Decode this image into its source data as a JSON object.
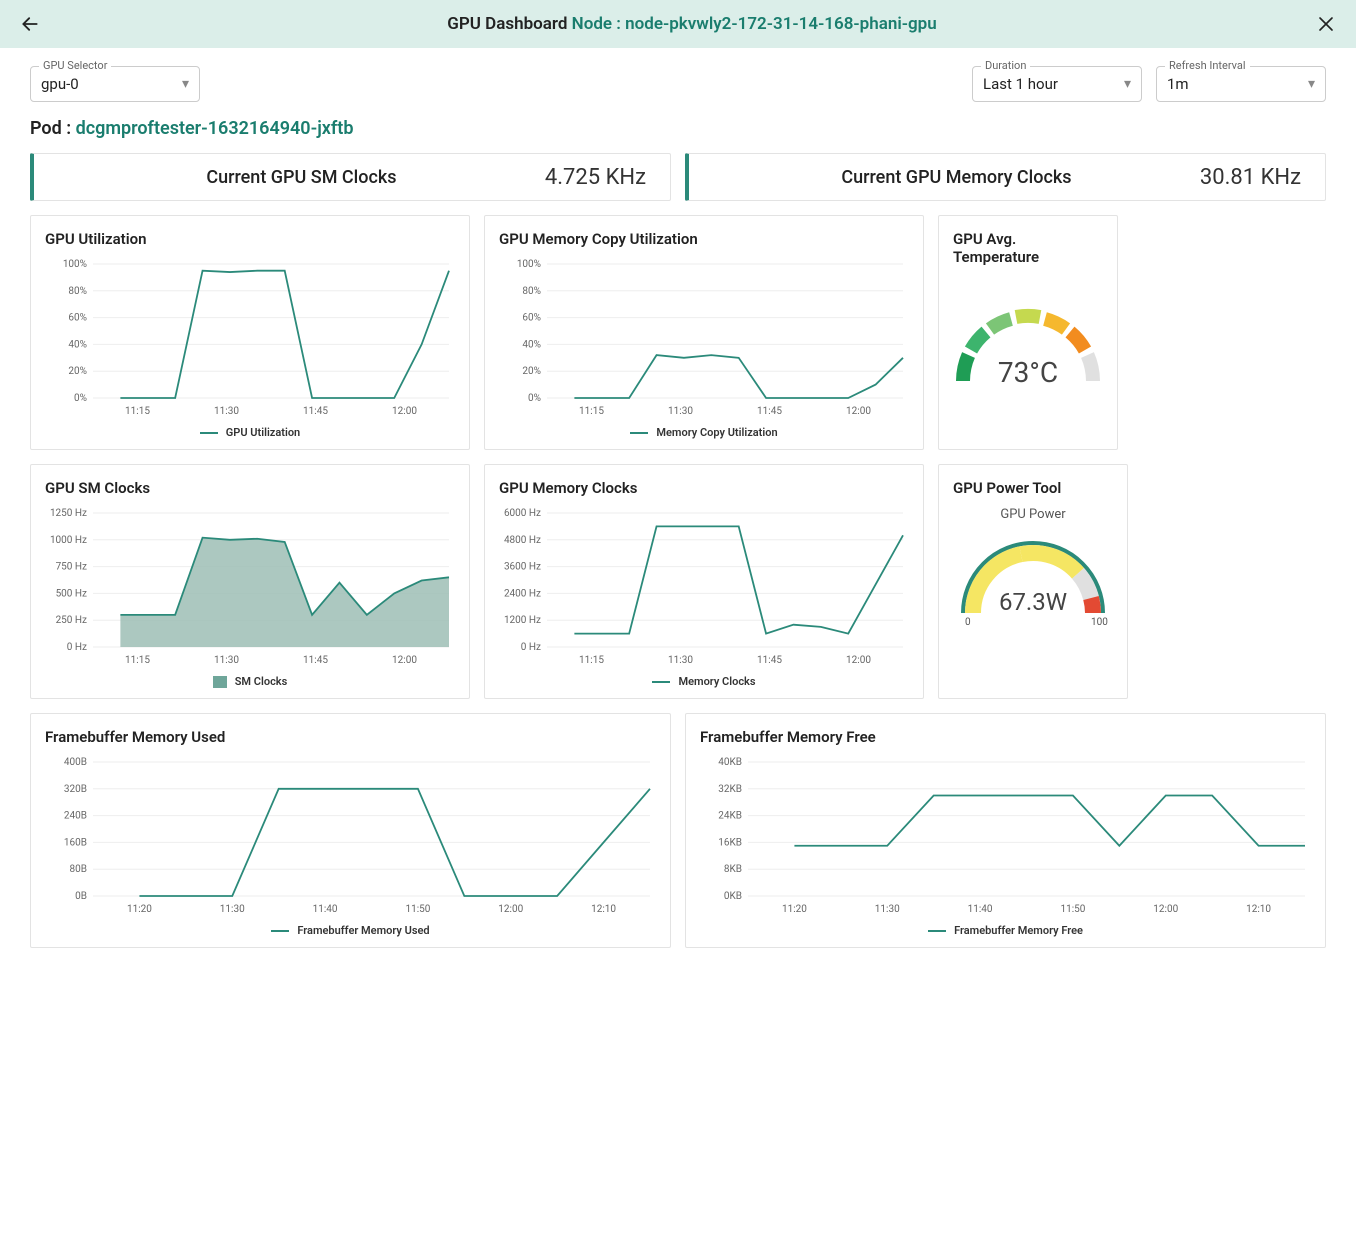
{
  "header": {
    "title_prefix": "GPU Dashboard",
    "node_label": "Node :",
    "node_name": "node-pkvwly2-172-31-14-168-phani-gpu"
  },
  "selectors": {
    "gpu": {
      "label": "GPU Selector",
      "value": "gpu-0"
    },
    "duration": {
      "label": "Duration",
      "value": "Last 1 hour"
    },
    "refresh": {
      "label": "Refresh Interval",
      "value": "1m"
    }
  },
  "pod": {
    "label": "Pod :",
    "name": "dcgmproftester-1632164940-jxftb"
  },
  "stats": {
    "sm_clocks": {
      "title": "Current GPU SM Clocks",
      "value": "4.725 KHz"
    },
    "mem_clocks": {
      "title": "Current GPU Memory Clocks",
      "value": "30.81 KHz"
    }
  },
  "temp_card": {
    "title": "GPU Avg. Temperature",
    "value": "73°C"
  },
  "power_card": {
    "title": "GPU Power Tool",
    "subtitle": "GPU Power",
    "value": "67.3W",
    "min": "0",
    "max": "100"
  },
  "chart_data": [
    {
      "id": "gpu_util",
      "type": "line",
      "title": "GPU Utilization",
      "legend": "GPU Utilization",
      "yticks": [
        "0%",
        "20%",
        "40%",
        "60%",
        "80%",
        "100%"
      ],
      "xticks": [
        "11:15",
        "11:30",
        "11:45",
        "12:00"
      ],
      "ylim": [
        0,
        100
      ],
      "x": [
        0,
        1,
        2,
        3,
        4,
        5,
        6,
        7,
        8,
        9,
        10,
        11,
        12,
        13
      ],
      "values": [
        null,
        0,
        0,
        0,
        95,
        94,
        95,
        95,
        0,
        0,
        0,
        0,
        40,
        95
      ]
    },
    {
      "id": "mem_copy_util",
      "type": "line",
      "title": "GPU Memory Copy Utilization",
      "legend": "Memory Copy Utilization",
      "yticks": [
        "0%",
        "20%",
        "40%",
        "60%",
        "80%",
        "100%"
      ],
      "xticks": [
        "11:15",
        "11:30",
        "11:45",
        "12:00"
      ],
      "ylim": [
        0,
        100
      ],
      "x": [
        0,
        1,
        2,
        3,
        4,
        5,
        6,
        7,
        8,
        9,
        10,
        11,
        12,
        13
      ],
      "values": [
        null,
        0,
        0,
        0,
        32,
        30,
        32,
        30,
        0,
        0,
        0,
        0,
        10,
        30
      ]
    },
    {
      "id": "sm_clocks",
      "type": "area",
      "title": "GPU SM Clocks",
      "legend": "SM Clocks",
      "yticks": [
        "0 Hz",
        "250 Hz",
        "500 Hz",
        "750 Hz",
        "1000 Hz",
        "1250 Hz"
      ],
      "xticks": [
        "11:15",
        "11:30",
        "11:45",
        "12:00"
      ],
      "ylim": [
        0,
        1250
      ],
      "x": [
        0,
        1,
        2,
        3,
        4,
        5,
        6,
        7,
        8,
        9,
        10,
        11,
        12,
        13
      ],
      "values": [
        null,
        300,
        300,
        300,
        1020,
        1000,
        1010,
        980,
        300,
        600,
        300,
        500,
        620,
        650
      ]
    },
    {
      "id": "mem_clocks",
      "type": "line",
      "title": "GPU Memory Clocks",
      "legend": "Memory Clocks",
      "yticks": [
        "0 Hz",
        "1200 Hz",
        "2400 Hz",
        "3600 Hz",
        "4800 Hz",
        "6000 Hz"
      ],
      "xticks": [
        "11:15",
        "11:30",
        "11:45",
        "12:00"
      ],
      "ylim": [
        0,
        6000
      ],
      "x": [
        0,
        1,
        2,
        3,
        4,
        5,
        6,
        7,
        8,
        9,
        10,
        11,
        12,
        13
      ],
      "values": [
        null,
        600,
        600,
        600,
        5400,
        5400,
        5400,
        5400,
        600,
        1000,
        900,
        600,
        2800,
        5000
      ]
    },
    {
      "id": "fb_used",
      "type": "line",
      "title": "Framebuffer Memory Used",
      "legend": "Framebuffer Memory Used",
      "yticks": [
        "0B",
        "80B",
        "160B",
        "240B",
        "320B",
        "400B"
      ],
      "xticks": [
        "11:20",
        "11:30",
        "11:40",
        "11:50",
        "12:00",
        "12:10"
      ],
      "ylim": [
        0,
        400
      ],
      "x": [
        0,
        1,
        2,
        3,
        4,
        5,
        6,
        7,
        8,
        9,
        10,
        11,
        12
      ],
      "values": [
        null,
        0,
        0,
        0,
        320,
        320,
        320,
        320,
        0,
        0,
        0,
        160,
        320
      ]
    },
    {
      "id": "fb_free",
      "type": "line",
      "title": "Framebuffer Memory Free",
      "legend": "Framebuffer Memory Free",
      "yticks": [
        "0KB",
        "8KB",
        "16KB",
        "24KB",
        "32KB",
        "40KB"
      ],
      "xticks": [
        "11:20",
        "11:30",
        "11:40",
        "11:50",
        "12:00",
        "12:10"
      ],
      "ylim": [
        0,
        40
      ],
      "x": [
        0,
        1,
        2,
        3,
        4,
        5,
        6,
        7,
        8,
        9,
        10,
        11,
        12
      ],
      "values": [
        null,
        15,
        15,
        15,
        30,
        30,
        30,
        30,
        15,
        30,
        30,
        15,
        15
      ]
    }
  ]
}
